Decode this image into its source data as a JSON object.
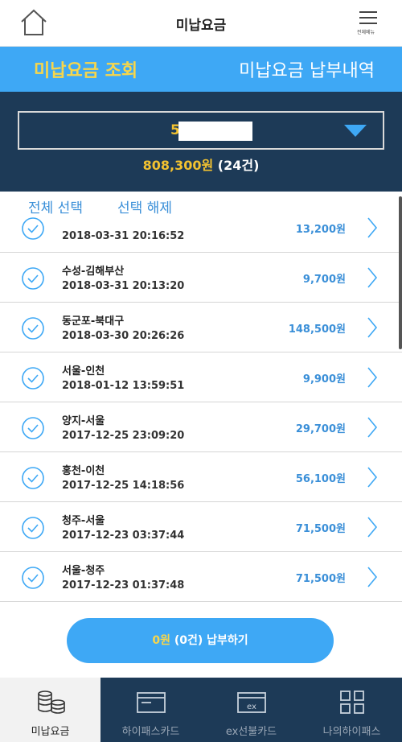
{
  "header": {
    "title": "미납요금",
    "menu_caption": "전체메뉴"
  },
  "tabs": [
    {
      "label": "미납요금 조회",
      "active": true
    },
    {
      "label": "미납요금 납부내역",
      "active": false
    }
  ],
  "account": {
    "value": "5",
    "total_amount": "808,300원",
    "total_count": "(24건)"
  },
  "select_actions": {
    "select_all": "전체 선택",
    "deselect": "선택 해제"
  },
  "unpaid_list": [
    {
      "route": "",
      "datetime": "2018-03-31 20:16:52",
      "amount": "13,200원",
      "checked": false
    },
    {
      "route": "수성-김해부산",
      "datetime": "2018-03-31 20:13:20",
      "amount": "9,700원",
      "checked": false
    },
    {
      "route": "동군포-북대구",
      "datetime": "2018-03-30 20:26:26",
      "amount": "148,500원",
      "checked": false
    },
    {
      "route": "서울-인천",
      "datetime": "2018-01-12 13:59:51",
      "amount": "9,900원",
      "checked": false
    },
    {
      "route": "양지-서울",
      "datetime": "2017-12-25 23:09:20",
      "amount": "29,700원",
      "checked": false
    },
    {
      "route": "홍천-이천",
      "datetime": "2017-12-25 14:18:56",
      "amount": "56,100원",
      "checked": false
    },
    {
      "route": "청주-서울",
      "datetime": "2017-12-23 03:37:44",
      "amount": "71,500원",
      "checked": false
    },
    {
      "route": "서울-청주",
      "datetime": "2017-12-23 01:37:48",
      "amount": "71,500원",
      "checked": false
    }
  ],
  "pay_button": {
    "amount": "0원",
    "count": "(0건)",
    "label": "납부하기"
  },
  "bottom_nav": [
    {
      "label": "미납요금",
      "icon": "coins-icon",
      "active": true
    },
    {
      "label": "하이패스카드",
      "icon": "card-icon",
      "active": false
    },
    {
      "label": "ex선불카드",
      "icon": "ex-card-icon",
      "active": false
    },
    {
      "label": "나의하이패스",
      "icon": "grid-icon",
      "active": false
    }
  ],
  "colors": {
    "accent_blue": "#3ea8f5",
    "highlight_yellow": "#f7d64b",
    "panel_navy": "#1d3a57",
    "amount_blue": "#3a8fd8"
  }
}
